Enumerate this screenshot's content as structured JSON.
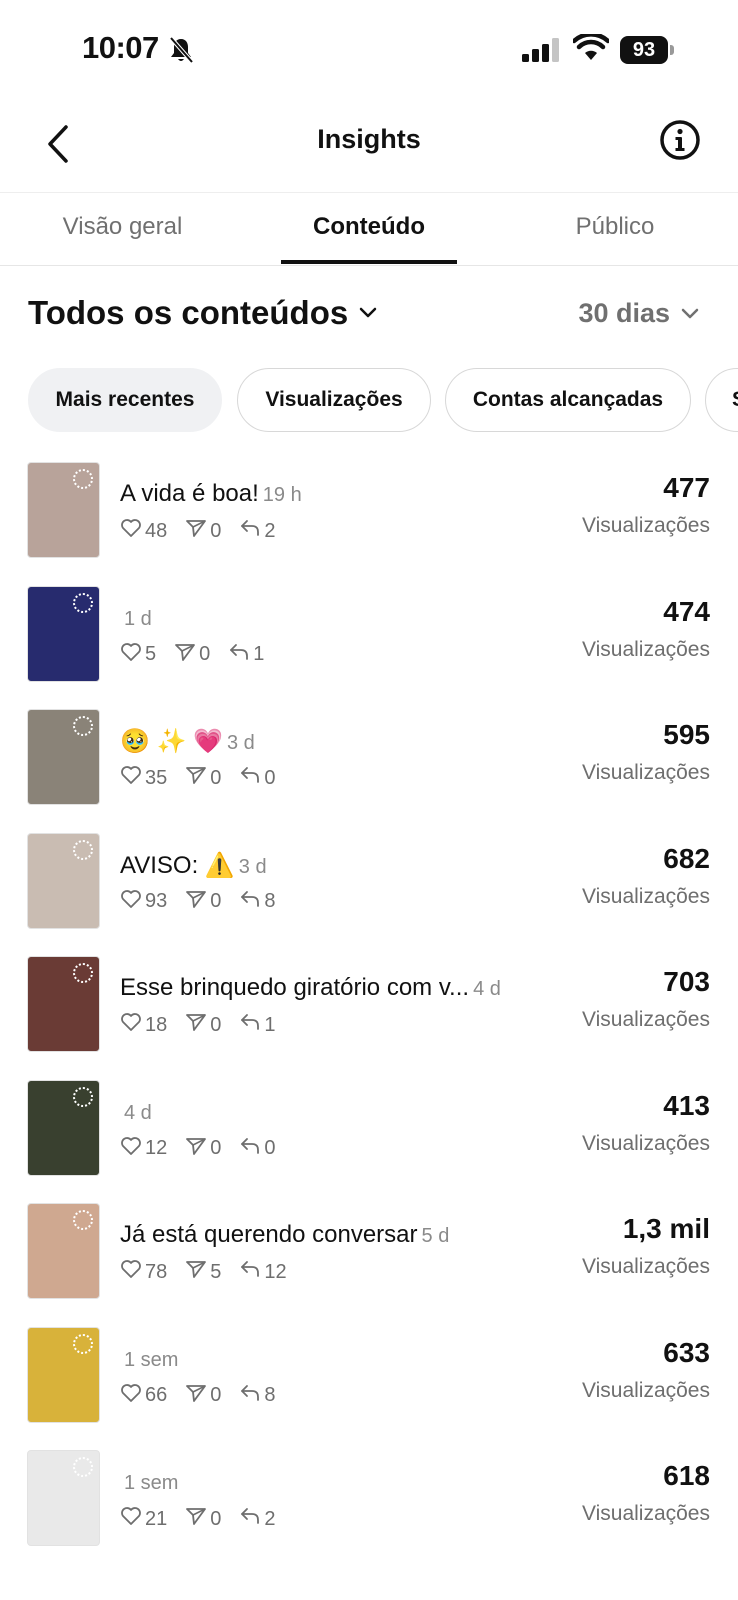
{
  "status": {
    "time": "10:07",
    "battery": "93"
  },
  "header": {
    "title": "Insights"
  },
  "tabs": [
    {
      "label": "Visão geral"
    },
    {
      "label": "Conteúdo"
    },
    {
      "label": "Público"
    }
  ],
  "filter": {
    "content_type": "Todos os conteúdos",
    "period": "30 dias"
  },
  "chips": [
    {
      "label": "Mais recentes"
    },
    {
      "label": "Visualizações"
    },
    {
      "label": "Contas alcançadas"
    },
    {
      "label": "S"
    }
  ],
  "metric_label": "Visualizações",
  "items": [
    {
      "caption": "A vida é boa!",
      "age": "19 h",
      "likes": "48",
      "shares": "0",
      "replies": "2",
      "value": "477",
      "label": "Visualizações",
      "thumb": "#b8a39a"
    },
    {
      "caption": "",
      "age": "1 d",
      "likes": "5",
      "shares": "0",
      "replies": "1",
      "value": "474",
      "label": "Visualizações",
      "thumb": "#272b6e"
    },
    {
      "caption": "🥹 ✨ 💗",
      "age": "3 d",
      "likes": "35",
      "shares": "0",
      "replies": "0",
      "value": "595",
      "label": "Visualizações",
      "thumb": "#8a8378"
    },
    {
      "caption": "AVISO: ⚠️",
      "age": "3 d",
      "likes": "93",
      "shares": "0",
      "replies": "8",
      "value": "682",
      "label": "Visualizações",
      "thumb": "#c9bcb2"
    },
    {
      "caption": "Esse brinquedo giratório com v...",
      "age": "4 d",
      "likes": "18",
      "shares": "0",
      "replies": "1",
      "value": "703",
      "label": "Visualizações",
      "thumb": "#6a3b35"
    },
    {
      "caption": "",
      "age": "4 d",
      "likes": "12",
      "shares": "0",
      "replies": "0",
      "value": "413",
      "label": "Visualizações",
      "thumb": "#39402f"
    },
    {
      "caption": "Já está querendo conversar",
      "age": "5 d",
      "likes": "78",
      "shares": "5",
      "replies": "12",
      "value": "1,3 mil",
      "label": "Visualizações",
      "thumb": "#cfa890"
    },
    {
      "caption": "",
      "age": "1 sem",
      "likes": "66",
      "shares": "0",
      "replies": "8",
      "value": "633",
      "label": "Visualizações",
      "thumb": "#d8b23a"
    },
    {
      "caption": "",
      "age": "1 sem",
      "likes": "21",
      "shares": "0",
      "replies": "2",
      "value": "618",
      "label": "Visualizações",
      "thumb": "#e9e9e9"
    }
  ]
}
